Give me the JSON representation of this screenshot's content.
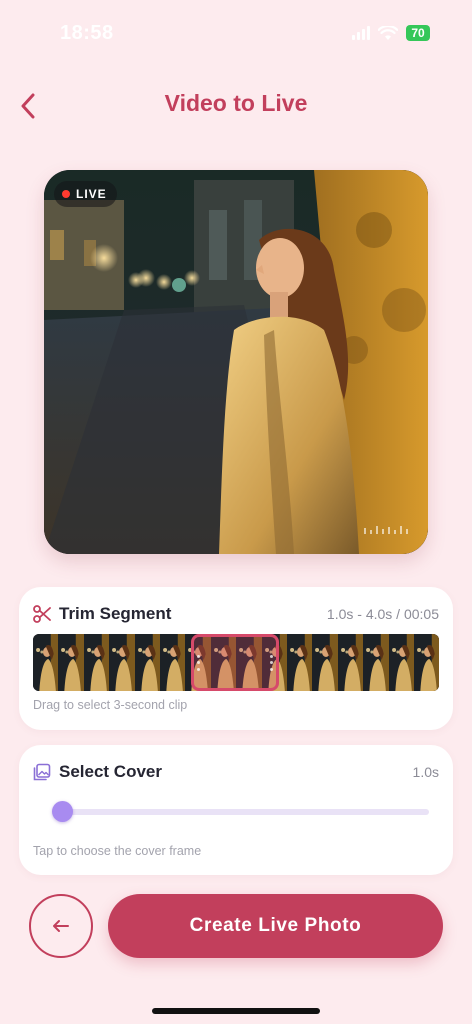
{
  "status_bar": {
    "time": "18:58",
    "battery": "70"
  },
  "header": {
    "title": "Video to Live",
    "back_icon": "chevron-left-icon"
  },
  "preview": {
    "badge_label": "LIVE",
    "badge_dot_color": "#ff3b30"
  },
  "trim": {
    "title": "Trim Segment",
    "icon": "scissors-icon",
    "range_text": "1.0s - 4.0s / 00:05",
    "hint": "Drag to select 3-second clip",
    "selection_start_s": 1.0,
    "selection_end_s": 4.0,
    "duration_s": 5
  },
  "cover": {
    "title": "Select Cover",
    "icon": "image-icon",
    "value_text": "1.0s",
    "hint": "Tap to choose the cover frame",
    "slider_value_s": 1.0
  },
  "actions": {
    "back_icon": "arrow-left-icon",
    "primary_label": "Create Live Photo"
  },
  "colors": {
    "accent": "#C23F5C",
    "background": "#FDEBEE",
    "slider_thumb": "#A88BF0",
    "slider_track": "#E9E2F6",
    "trim_border": "#D64A6A"
  }
}
